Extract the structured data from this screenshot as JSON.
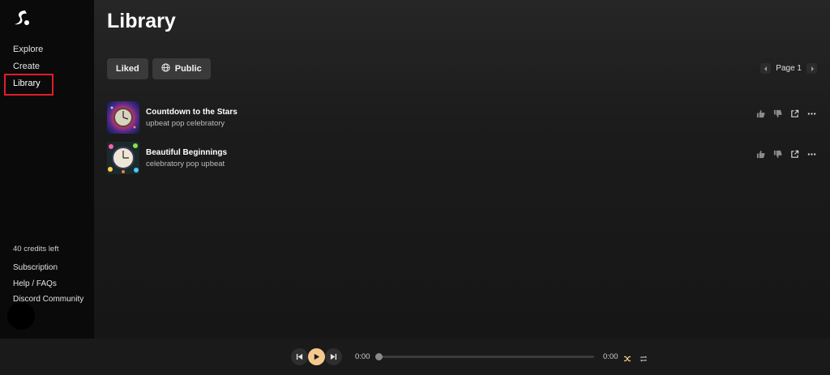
{
  "sidebar": {
    "items": [
      {
        "label": "Explore"
      },
      {
        "label": "Create"
      },
      {
        "label": "Library"
      }
    ],
    "credits": "40 credits left",
    "links": [
      {
        "label": "Subscription"
      },
      {
        "label": "Help / FAQs"
      },
      {
        "label": "Discord Community"
      }
    ]
  },
  "main": {
    "title": "Library",
    "filters": [
      {
        "label": "Liked"
      },
      {
        "label": "Public"
      }
    ],
    "pager": {
      "label": "Page 1"
    },
    "songs": [
      {
        "title": "Countdown to the Stars",
        "tags": "upbeat pop celebratory"
      },
      {
        "title": "Beautiful Beginnings",
        "tags": "celebratory pop upbeat"
      }
    ]
  },
  "player": {
    "current_time": "0:00",
    "duration": "0:00",
    "progress": 0
  },
  "colors": {
    "accent": "#f5c98b",
    "highlight_box": "#e11d2a"
  }
}
